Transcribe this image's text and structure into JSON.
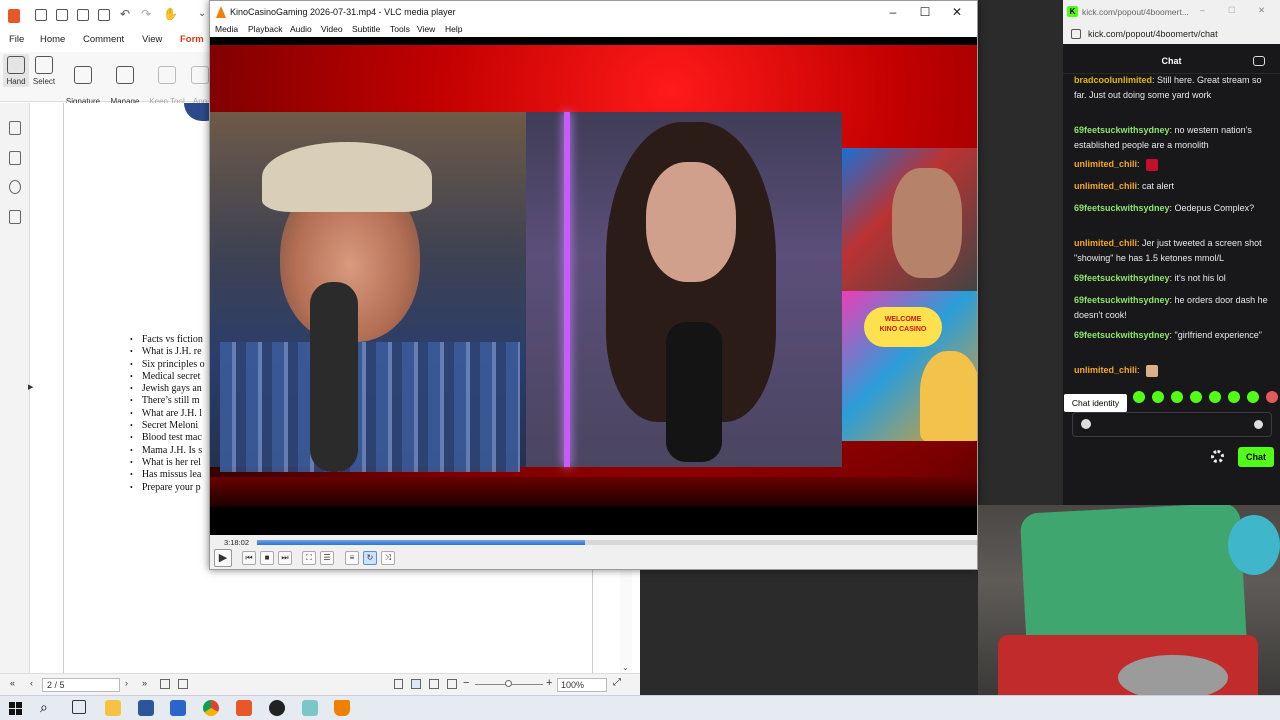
{
  "pdf": {
    "menus": [
      "File",
      "Home",
      "Comment",
      "View",
      "Form"
    ],
    "active_menu": "Form",
    "ribbon": [
      {
        "label": "Hand",
        "icon": "hand-icon"
      },
      {
        "label": "Select",
        "icon": "select-icon"
      },
      {
        "label": "Signature\nList",
        "icon": "signature-icon"
      },
      {
        "label": "Manage\nSignatures",
        "icon": "manage-signatures-icon"
      },
      {
        "label": "Keep Tool\nSelected",
        "icon": "pin-icon"
      },
      {
        "label": "App\nSign",
        "icon": "app-sign-icon"
      }
    ],
    "bullets": [
      "Facts vs fiction",
      "What is J.H. re",
      "Six principles o",
      "Medical secret",
      "Jewish gays an",
      "There’s still m",
      "What are J.H. l",
      "Secret Meloni",
      "Blood test mac",
      "Mama J.H. Is s",
      "What is her rel",
      "Has missus lea",
      "Prepare your p"
    ],
    "page_indicator": "2 / 5",
    "zoom": "100%"
  },
  "vlc": {
    "title": "KinoCasinoGaming 2026-07-31.mp4 - VLC media player",
    "menus": [
      "Media",
      "Playback",
      "Audio",
      "Video",
      "Subtitle",
      "Tools",
      "View",
      "Help"
    ],
    "time": "3:18:02",
    "progress": 0.455,
    "overlay_sign": "WELCOME\nKINO CASINO"
  },
  "chat": {
    "tab_url": "kick.com/popout/4boomert...",
    "url": "kick.com/popout/4boomertv/chat",
    "header": "Chat",
    "messages": [
      {
        "user": "bradcoolunlimited",
        "text": ": Still here. Great stream so far. Just out doing some yard work",
        "color": "#e0b800"
      },
      {
        "user": "69feetsuckwithsydney",
        "text": ": no western nation's established people are a monolith",
        "color": "#8ee56a"
      },
      {
        "user": "unlimited_chili",
        "text": ":",
        "color": "#f5a623"
      },
      {
        "user": "unlimited_chili",
        "text": ": cat alert",
        "color": "#f5a623"
      },
      {
        "user": "69feetsuckwithsydney",
        "text": ": Oedepus Complex?",
        "color": "#8ee56a"
      },
      {
        "user": "unlimited_chili",
        "text": ": Jer just tweeted a screen shot \"showing\" he has 1.5 ketones mmol/L",
        "color": "#f5a623"
      },
      {
        "user": "69feetsuckwithsydney",
        "text": ": it's not his lol",
        "color": "#8ee56a"
      },
      {
        "user": "69feetsuckwithsydney",
        "text": ": he orders door dash he doesn't cook!",
        "color": "#8ee56a"
      },
      {
        "user": "69feetsuckwithsydney",
        "text": ": \"girlfriend experience\"",
        "color": "#8ee56a"
      },
      {
        "user": "unlimited_chili",
        "text": ":",
        "color": "#f5a623"
      }
    ],
    "tooltip": "Chat identity",
    "send_label": "Chat",
    "accent": "#53fc18"
  },
  "taskbar": {
    "apps": [
      "file-explorer-icon",
      "word-icon",
      "powershell-icon",
      "chrome-icon",
      "pdf-editor-icon",
      "obs-icon",
      "notepad-icon",
      "vlc-icon"
    ]
  }
}
